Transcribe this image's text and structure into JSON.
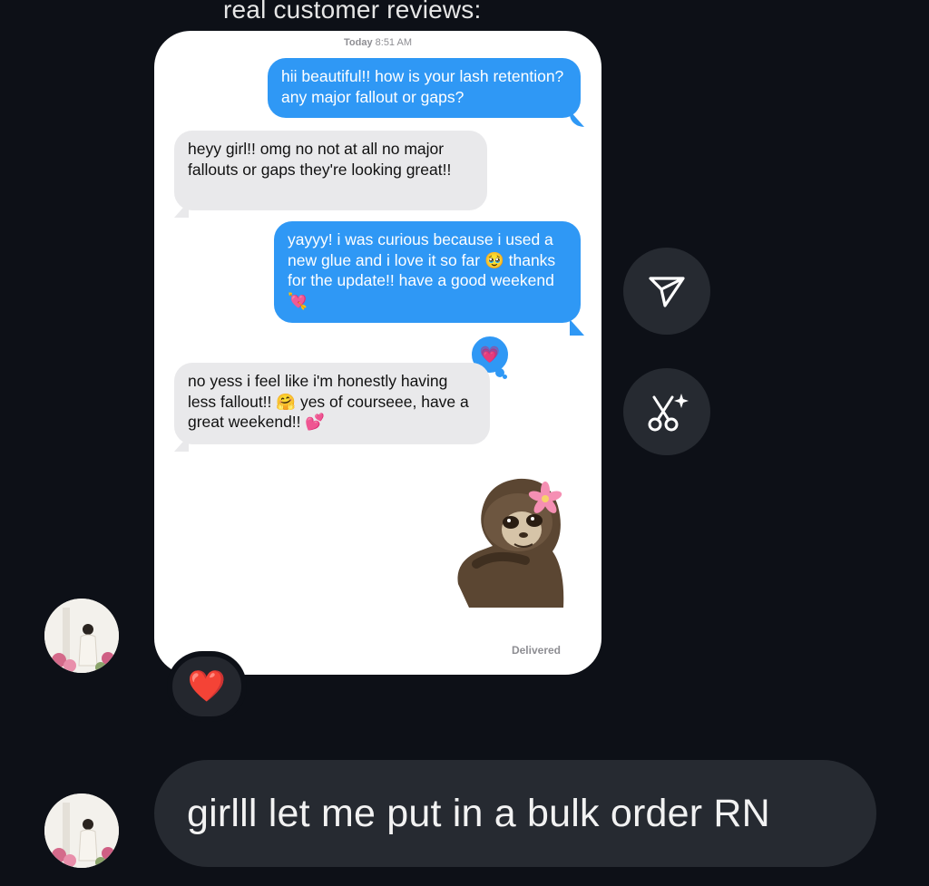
{
  "caption": "real customer reviews:",
  "screenshot": {
    "timestamp_day": "Today",
    "timestamp_time": "8:51 AM",
    "messages": [
      {
        "dir": "out",
        "text": "hii beautiful!! how is your lash retention? any major fallout or gaps?"
      },
      {
        "dir": "in",
        "text": "heyy girl!! omg no not at all no major fallouts or gaps they're looking great!!"
      },
      {
        "dir": "out",
        "text": "yayyy! i was curious because i used a new glue and i love it so far",
        "emoji_mid": "🥹",
        "text2": "thanks for the update!! have a good weekend",
        "emoji_end": "💘"
      },
      {
        "dir": "in",
        "text": "no yess i feel like i'm honestly having less fallout!!",
        "emoji_mid": "🤗",
        "text2": "yes of courseee, have a great weekend!!",
        "emoji_end": "💕"
      }
    ],
    "tapback": "💗",
    "status": "Delivered"
  },
  "reaction": "❤️",
  "reply_message": "girlll let me put in a bulk order RN",
  "actions": [
    "share-icon",
    "ai-scissors-icon"
  ],
  "colors": {
    "background": "#0d1017",
    "imessage_blue": "#2f98f5",
    "incoming_gray": "#e9e9eb",
    "pill": "#262a31"
  }
}
